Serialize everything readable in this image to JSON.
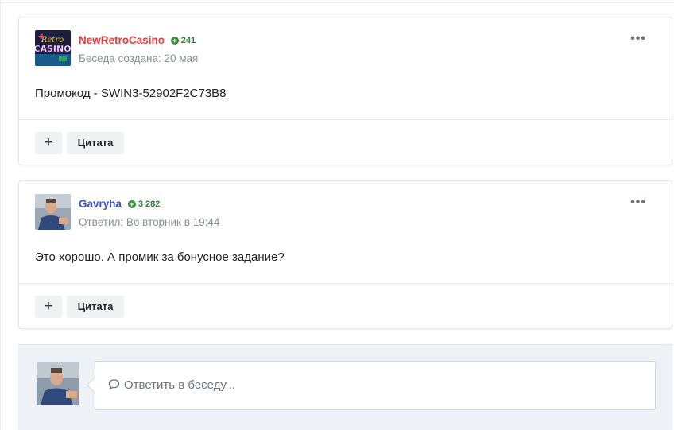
{
  "posts": [
    {
      "author": "NewRetroCasino",
      "author_color": "#e04040",
      "reputation": "241",
      "meta": "Беседа создана: 20 мая",
      "content": "Промокод -  SWIN3-52902F2C73B8",
      "avatar_logo_lines": [
        "Retro",
        "CASINO"
      ],
      "add_label": "+",
      "quote_label": "Цитата"
    },
    {
      "author": "Gavryha",
      "author_color": "#3d4fc4",
      "reputation": "3 282",
      "meta": "Ответил: Во вторник в 19:44",
      "content": "Это хорошо. А промик за бонусное задание?",
      "add_label": "+",
      "quote_label": "Цитата"
    }
  ],
  "reply": {
    "placeholder": "Ответить в беседу..."
  },
  "icons": {
    "more": "more-dots-icon",
    "reputation": "plus-circle-icon",
    "chat": "chat-bubble-icon"
  }
}
